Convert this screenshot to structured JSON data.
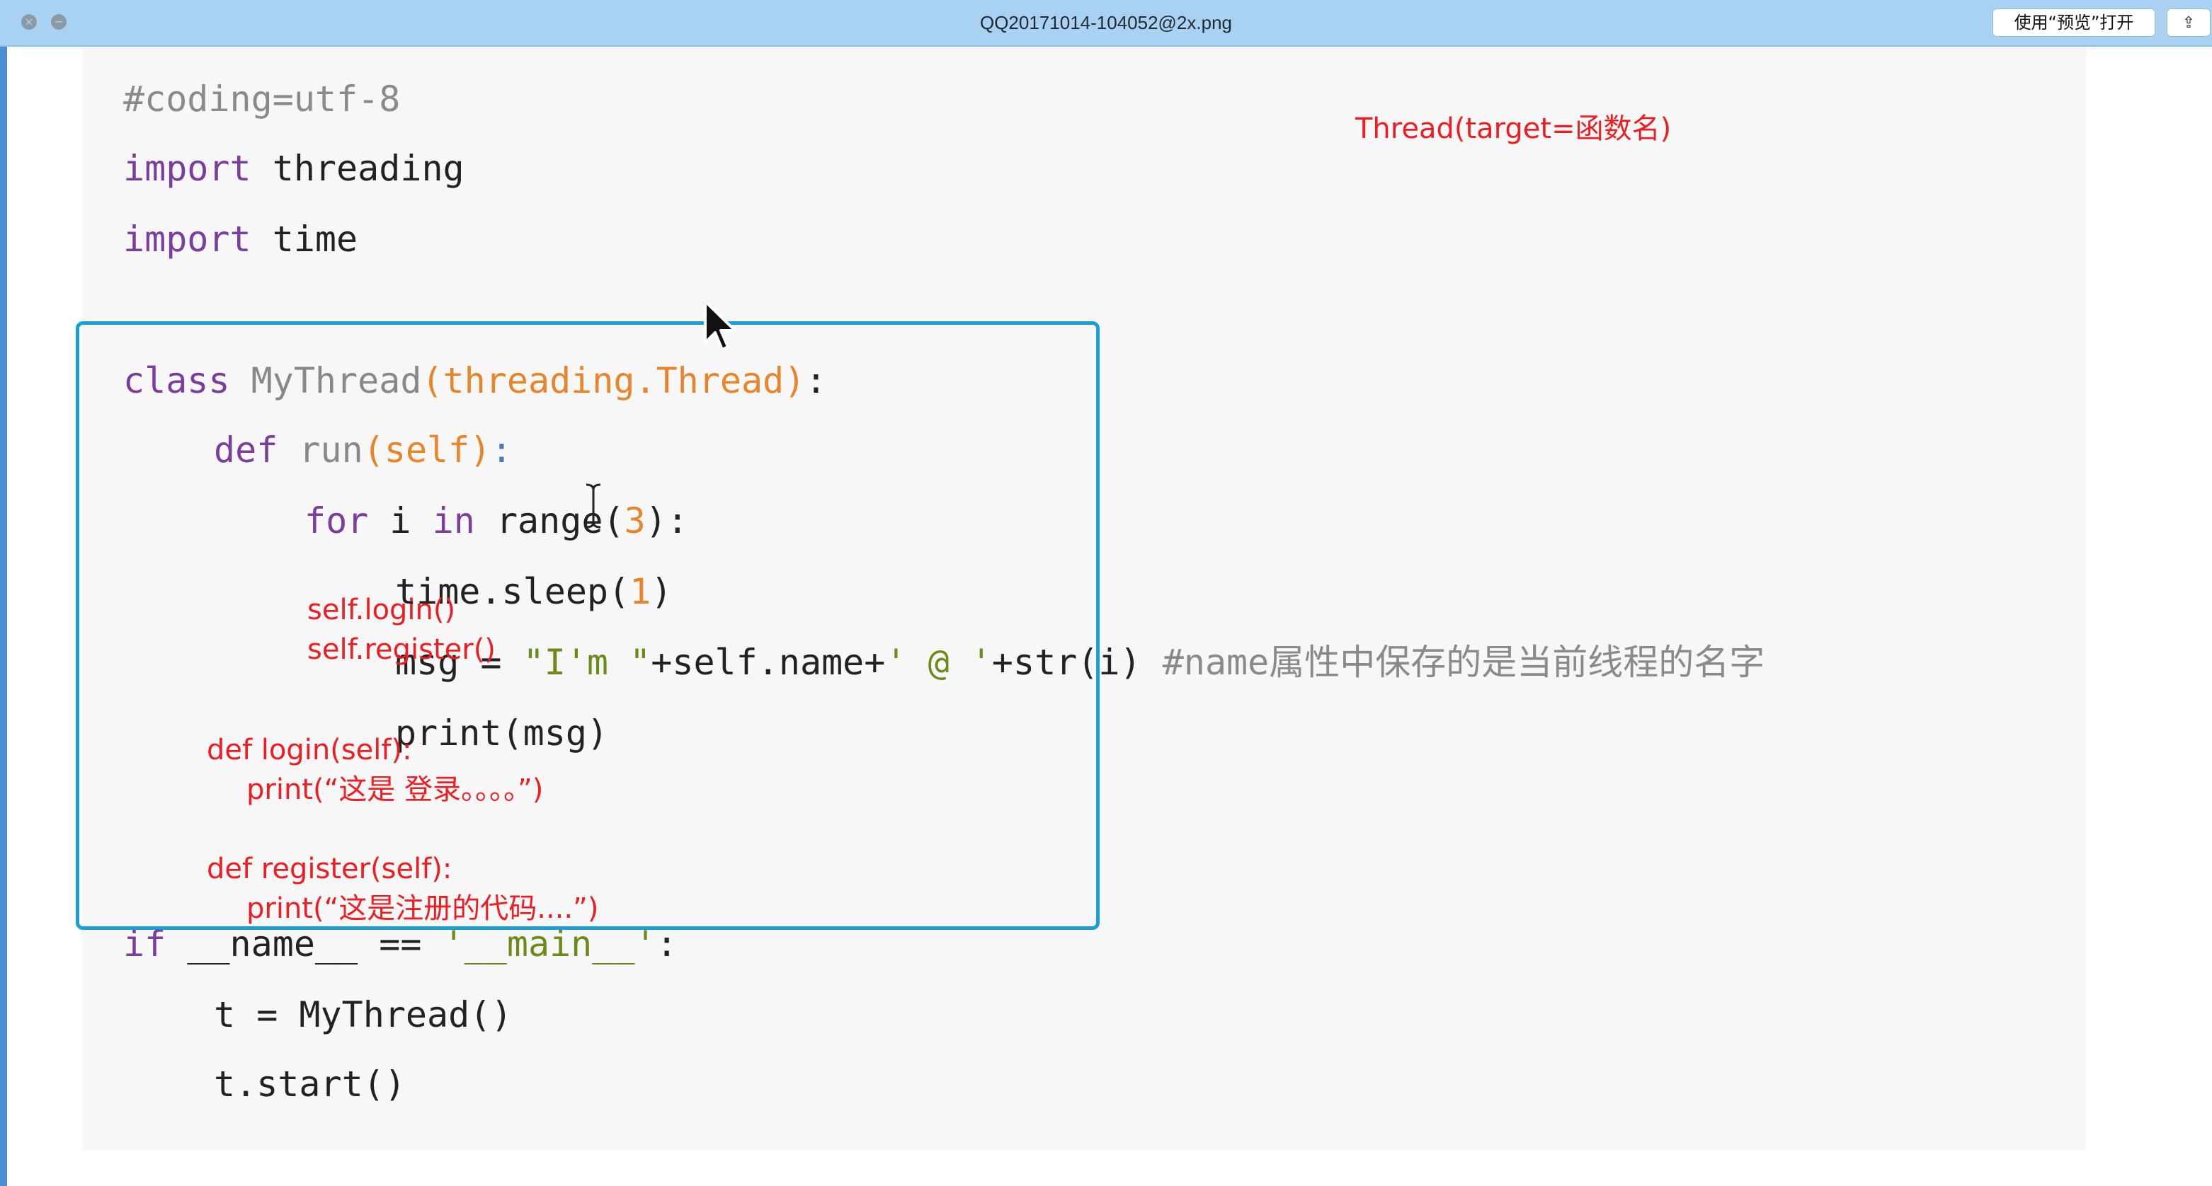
{
  "window": {
    "title": "QQ20171014-104052@2x.png",
    "open_with_preview": "使用“预览”打开",
    "close_glyph": "×",
    "min_glyph": "−",
    "share_glyph": "⇪"
  },
  "code": {
    "line1": "#coding=utf-8",
    "line2_kw": "import",
    "line2_rest": " threading",
    "line3_kw": "import",
    "line3_rest": " time",
    "line4_kw": "class",
    "line4_name": " MyThread",
    "line4_arg": "(threading.Thread)",
    "line4_end": ":",
    "line5_kw": "def",
    "line5_name": " run",
    "line5_arg": "(self)",
    "line5_end": ":",
    "line6_for": "for",
    "line6_i": " i ",
    "line6_in": "in",
    "line6_range": " range(",
    "line6_num": "3",
    "line6_end": "):",
    "line7_a": "time.sleep(",
    "line7_num": "1",
    "line7_b": ")",
    "line8_a": "msg = ",
    "line8_str1": "\"I'm \"",
    "line8_b": "+self.name+",
    "line8_str2": "' @ '",
    "line8_c": "+str(i) ",
    "line8_comment": "#name属性中保存的是当前线程的名字",
    "line9": "print(msg)",
    "line10_kw": "if",
    "line10_a": " __name__ == ",
    "line10_str": "'__main__'",
    "line10_b": ":",
    "line11": "t = MyThread()",
    "line12": "t.start()"
  },
  "annotations": {
    "thread_target": "Thread(target=函数名)",
    "self_login": "self.login()",
    "self_register": "self.register()",
    "def_login": "def login(self):",
    "print_login": "print(“这是 登录。。。。”)",
    "def_register": "def register(self):",
    "print_register": "print(“这是注册的代码....”)"
  },
  "colors": {
    "keyword": "#7a3e9d",
    "argument": "#e8852a",
    "string": "#6c8a1a",
    "annotation": "#ee1d23",
    "highlight_box": "#1a9ed6"
  }
}
